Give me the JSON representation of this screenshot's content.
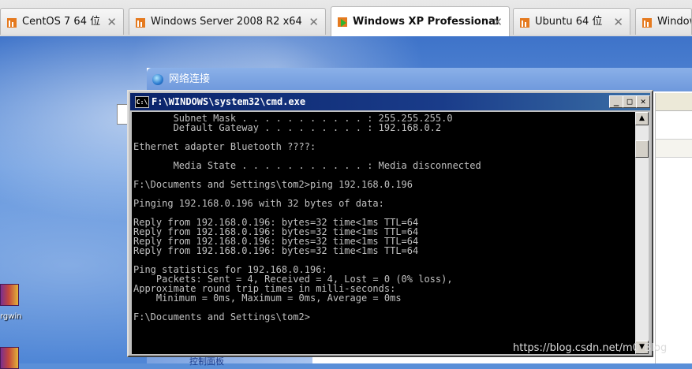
{
  "vm_tabs": [
    {
      "label": "CentOS 7 64 位",
      "icon": "vm-icon",
      "active": false
    },
    {
      "label": "Windows Server 2008 R2 x64",
      "icon": "vm-icon",
      "active": false
    },
    {
      "label": "Windows XP Professional",
      "icon": "vm-running-icon",
      "active": true
    },
    {
      "label": "Ubuntu 64 位",
      "icon": "vm-icon",
      "active": false
    },
    {
      "label": "Window",
      "icon": "vm-icon",
      "active": false
    }
  ],
  "tab_close_glyph": "✕",
  "network_window": {
    "title": "网络连接",
    "side_item": "控制面板"
  },
  "desktop": {
    "icon_label": "rgwin"
  },
  "cmd": {
    "title": "F:\\WINDOWS\\system32\\cmd.exe",
    "icon_text": "C:\\",
    "buttons": {
      "minimize": "_",
      "maximize": "□",
      "close": "✕"
    },
    "lines": [
      "       Subnet Mask . . . . . . . . . . . : 255.255.255.0",
      "       Default Gateway . . . . . . . . . : 192.168.0.2",
      "",
      "Ethernet adapter Bluetooth ????:",
      "",
      "       Media State . . . . . . . . . . . : Media disconnected",
      "",
      "F:\\Documents and Settings\\tom2>ping 192.168.0.196",
      "",
      "Pinging 192.168.0.196 with 32 bytes of data:",
      "",
      "Reply from 192.168.0.196: bytes=32 time<1ms TTL=64",
      "Reply from 192.168.0.196: bytes=32 time<1ms TTL=64",
      "Reply from 192.168.0.196: bytes=32 time<1ms TTL=64",
      "Reply from 192.168.0.196: bytes=32 time<1ms TTL=64",
      "",
      "Ping statistics for 192.168.0.196:",
      "    Packets: Sent = 4, Received = 4, Lost = 0 (0% loss),",
      "Approximate round trip times in milli-seconds:",
      "    Minimum = 0ms, Maximum = 0ms, Average = 0ms",
      "",
      "F:\\Documents and Settings\\tom2>"
    ],
    "scroll_up": "▲",
    "scroll_down": "▼"
  },
  "watermark": "https://blog.csdn.net/m0_Blog",
  "colors": {
    "console_bg": "#000000",
    "console_fg": "#c0c0c0",
    "cmd_title": "#0a246a",
    "xp_desktop": "#5a8fd8"
  }
}
